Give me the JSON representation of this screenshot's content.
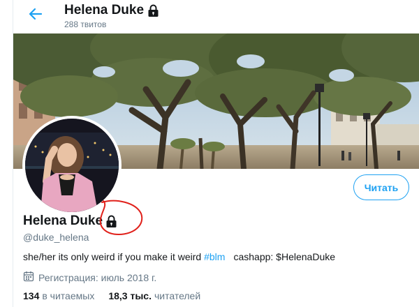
{
  "header": {
    "name": "Helena Duke",
    "tweet_count": "288 твитов",
    "back_icon": "arrow-left-icon",
    "lock_icon": "lock-icon"
  },
  "banner": {
    "description_icon": "banner-image"
  },
  "follow_button": {
    "label": "Читать"
  },
  "profile": {
    "name": "Helena Duke",
    "handle": "@duke_helena",
    "bio": {
      "text_before": "she/her its only weird if you make it weird ",
      "hashtag": "#blm",
      "text_after": "cashapp: $HelenaDuke"
    },
    "joined": "Регистрация: июль 2018 г.",
    "joined_icon": "calendar-icon"
  },
  "stats": {
    "following_count": "134",
    "following_label": "в читаемых",
    "followers_count": "18,3 тыс.",
    "followers_label": "читателей"
  },
  "colors": {
    "accent": "#1da1f2",
    "text": "#14171a",
    "secondary": "#657786",
    "annotation": "#e0201a"
  }
}
